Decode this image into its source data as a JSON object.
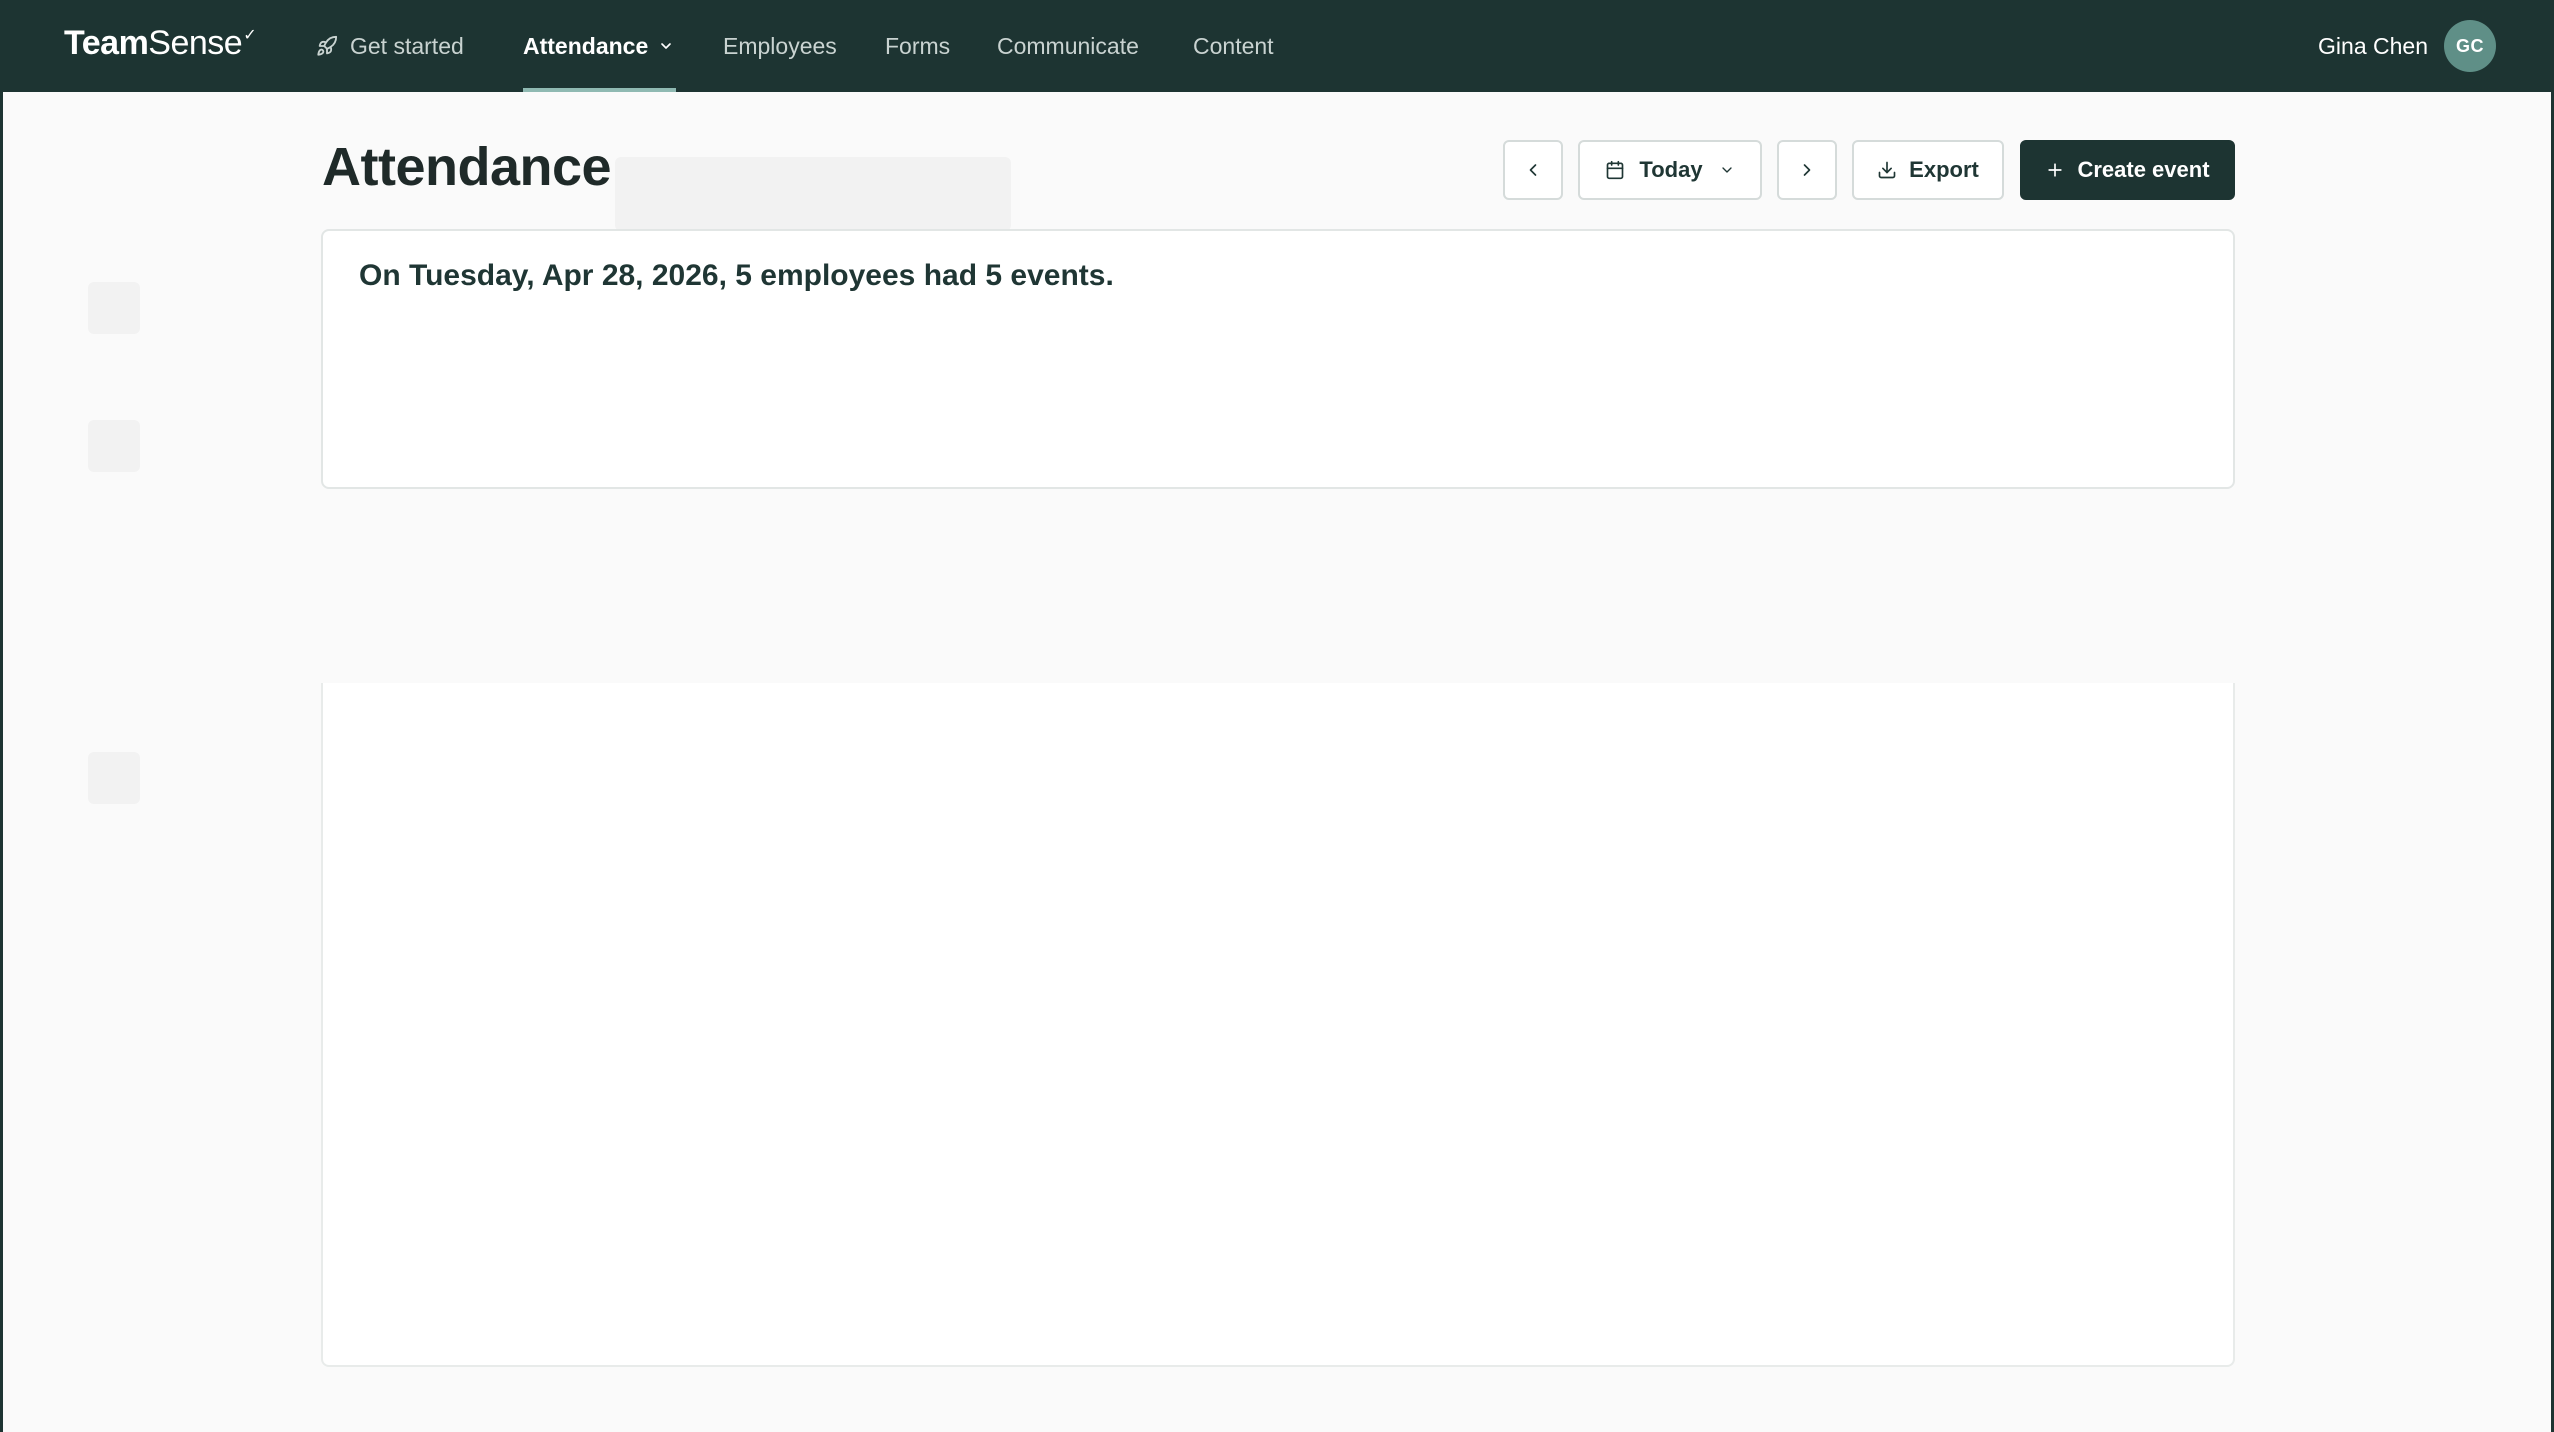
{
  "app": {
    "logo_primary": "Team",
    "logo_secondary": "Sense",
    "logo_mark": "✓"
  },
  "nav": {
    "get_started": "Get started",
    "attendance": "Attendance",
    "employees": "Employees",
    "forms": "Forms",
    "communicate": "Communicate",
    "content": "Content"
  },
  "user": {
    "name": "Gina Chen",
    "initials": "GC"
  },
  "page": {
    "title": "Attendance"
  },
  "toolbar": {
    "date_label": "Today",
    "export_label": "Export",
    "create_label": "Create event"
  },
  "summary": {
    "text": "On Tuesday, Apr 28, 2026, 5 employees had 5 events."
  },
  "colors": {
    "brand_dark": "#1d3432",
    "accent_underline": "#8fb9b2",
    "avatar_bg": "#5f8f87"
  },
  "icons": {
    "get_started": "rocket-icon",
    "attendance_dropdown": "chevron-down-icon",
    "prev": "chevron-left-icon",
    "calendar": "calendar-icon",
    "date_dropdown": "chevron-down-icon",
    "next": "chevron-right-icon",
    "export": "download-icon",
    "create": "plus-icon"
  }
}
